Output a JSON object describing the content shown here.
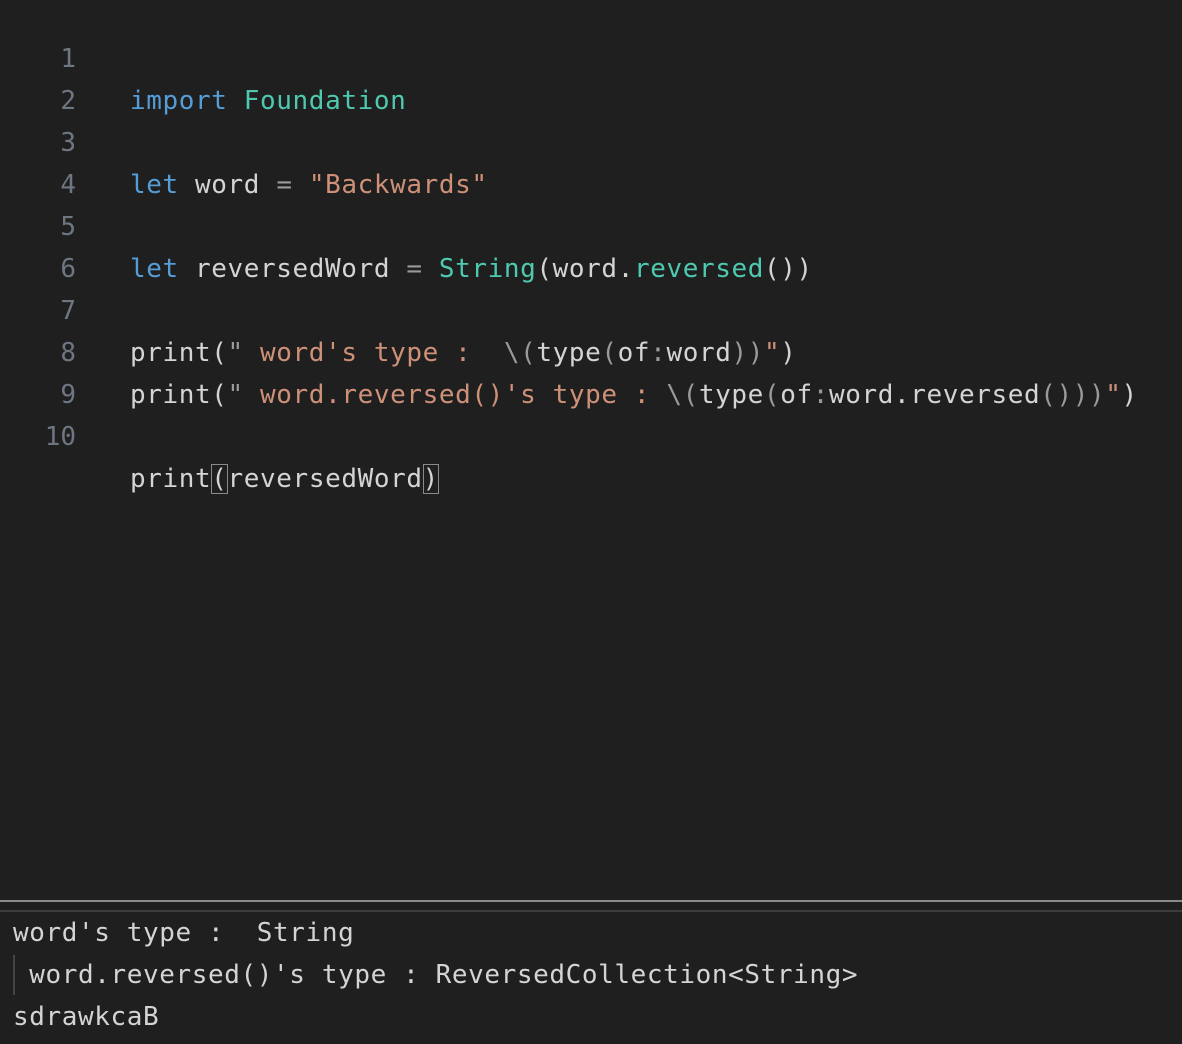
{
  "editor": {
    "lines": [
      {
        "number": "1",
        "tokens": [
          "import",
          "Foundation"
        ]
      },
      {
        "number": "2"
      },
      {
        "number": "3",
        "tokens": [
          "let",
          "word",
          "=",
          "\"Backwards\""
        ]
      },
      {
        "number": "4"
      },
      {
        "number": "5",
        "tokens": [
          "let",
          "reversedWord",
          "=",
          "String",
          "(",
          "word",
          ".",
          "reversed",
          "())"
        ]
      },
      {
        "number": "6"
      },
      {
        "number": "7",
        "tokens": [
          "print(",
          "\"",
          " word's type :  ",
          "\\(",
          "type",
          "(",
          "of",
          ":",
          "word",
          "))",
          "\"",
          ")"
        ]
      },
      {
        "number": "8",
        "tokens": [
          "print(",
          "\"",
          " word.reversed()'s type : ",
          "\\(",
          "type",
          "(",
          "of",
          ":",
          "word.reversed",
          "()))",
          "\"",
          ")"
        ]
      },
      {
        "number": "9"
      },
      {
        "number": "10",
        "tokens": [
          "print",
          "(",
          "reversedWord",
          ")"
        ]
      }
    ]
  },
  "console": {
    "output": [
      "word's type :  String",
      " word.reversed()'s type : ReversedCollection<String>",
      "sdrawkcaB"
    ]
  },
  "colors": {
    "background": "#1f1f1f",
    "keyword": "#569cd6",
    "type": "#4ec9b0",
    "string": "#ce9178",
    "text": "#d4d4d4",
    "line_number": "#6e7681"
  }
}
